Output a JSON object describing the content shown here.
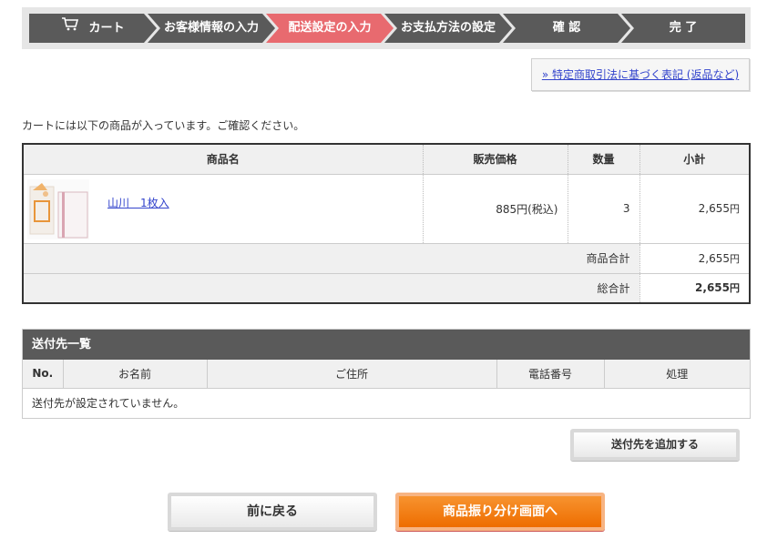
{
  "steps": [
    {
      "label": "カート",
      "icon": "cart-icon"
    },
    {
      "label": "お客様情報の入力"
    },
    {
      "label": "配送設定の入力",
      "active": true
    },
    {
      "label": "お支払方法の設定"
    },
    {
      "label": "確 認"
    },
    {
      "label": "完 了"
    }
  ],
  "law_link": "» 特定商取引法に基づく表記 (返品など)",
  "intro": "カートには以下の商品が入っています。ご確認ください。",
  "cart": {
    "headers": {
      "name": "商品名",
      "price": "販売価格",
      "qty": "数量",
      "subtotal": "小計"
    },
    "item": {
      "name": "山川　1枚入",
      "price": "885",
      "tax": "(税込)",
      "qty": "3",
      "subtotal": "2,655"
    },
    "yen": "円",
    "goods_total_label": "商品合計",
    "goods_total": "2,655",
    "grand_total_label": "総合計",
    "grand_total": "2,655"
  },
  "shipping": {
    "title": "送付先一覧",
    "headers": {
      "no": "No.",
      "name": "お名前",
      "address": "ご住所",
      "phone": "電話番号",
      "action": "処理"
    },
    "empty": "送付先が設定されていません。"
  },
  "buttons": {
    "add": "送付先を追加する",
    "back": "前に戻る",
    "next": "商品振り分け画面へ"
  },
  "colors": {
    "step_bg": "#5a5a5a",
    "step_active": "#e86a6f",
    "accent_orange": "#ee6d00",
    "link": "#3344cc"
  }
}
